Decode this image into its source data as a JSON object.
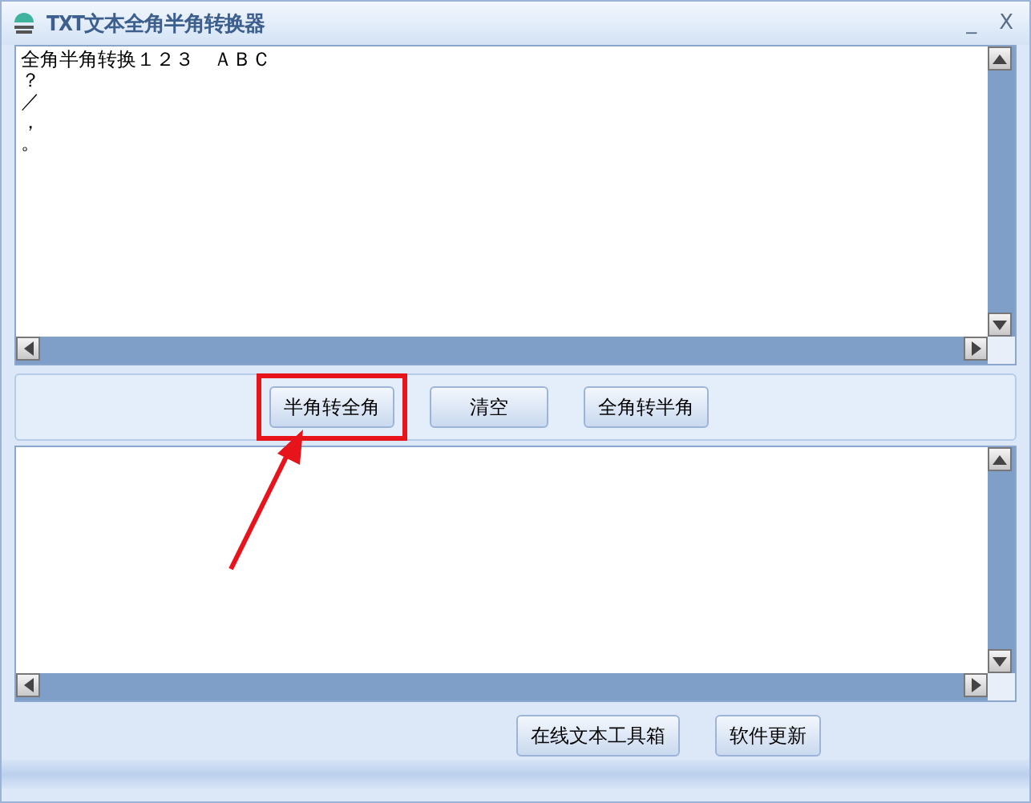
{
  "window": {
    "title": "TXT文本全角半角转换器",
    "buttons": [
      "_",
      "X"
    ]
  },
  "input_pane": {
    "lines": [
      "全角半角转换１２３　ＡＢＣ",
      "？",
      "／",
      "，",
      "。"
    ]
  },
  "actions": [
    {
      "label": "半角转全角",
      "highlighted": true
    },
    {
      "label": "清空",
      "highlighted": false
    },
    {
      "label": "全角转半角",
      "highlighted": false
    }
  ],
  "footer_buttons": [
    "在线文本工具箱",
    "软件更新"
  ]
}
